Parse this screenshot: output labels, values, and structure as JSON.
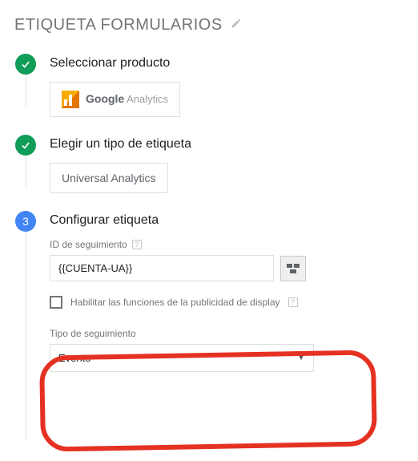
{
  "header": {
    "title": "ETIQUETA FORMULARIOS"
  },
  "steps": {
    "product": {
      "title": "Seleccionar producto",
      "card": {
        "google": "Google",
        "analytics": " Analytics"
      }
    },
    "tagType": {
      "title": "Elegir un tipo de etiqueta",
      "card": "Universal Analytics"
    },
    "configure": {
      "badge": "3",
      "title": "Configurar etiqueta",
      "trackingId": {
        "label": "ID de seguimiento",
        "value": "{{CUENTA-UA}}"
      },
      "displayFeatures": {
        "label": "Habilitar las funciones de la publicidad de display"
      },
      "trackingType": {
        "label": "Tipo de seguimiento",
        "value": "Evento"
      }
    }
  }
}
